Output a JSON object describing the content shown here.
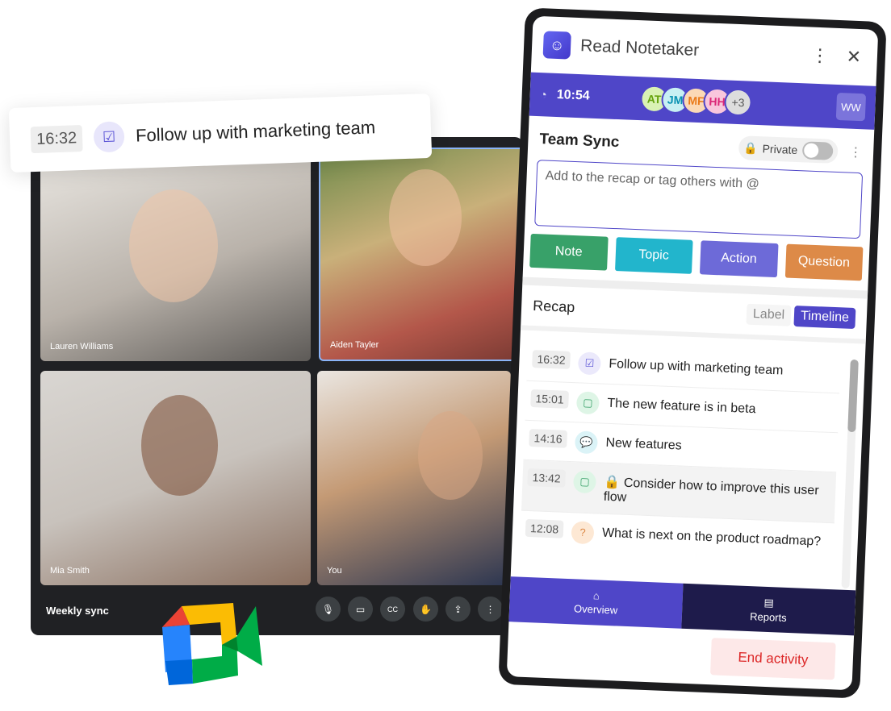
{
  "meet": {
    "title": "Weekly sync",
    "tiles": [
      {
        "name": "Lauren Williams"
      },
      {
        "name": "Aiden Tayler"
      },
      {
        "name": "Mia Smith"
      },
      {
        "name": "You"
      }
    ],
    "controls": [
      "microphone-icon",
      "camera-icon",
      "captions-icon",
      "raise-hand-icon",
      "present-icon",
      "more-icon"
    ]
  },
  "toast": {
    "time": "16:32",
    "text": "Follow up with marketing team"
  },
  "notetaker": {
    "title": "Read Notetaker",
    "timer": "10:54",
    "participants": [
      {
        "initials": "AT",
        "bg": "#d9f2b4",
        "fg": "#65a30d"
      },
      {
        "initials": "JM",
        "bg": "#c8f0f3",
        "fg": "#0891b2"
      },
      {
        "initials": "MF",
        "bg": "#fbd9b6",
        "fg": "#ea7a1a"
      },
      {
        "initials": "HH",
        "bg": "#f9c6dc",
        "fg": "#db2777"
      }
    ],
    "more_participants": "+3",
    "user_initials": "WW",
    "meeting_title": "Team Sync",
    "private_label": "Private",
    "private_on": false,
    "input_placeholder": "Add to the recap or tag others with @",
    "buttons": {
      "note": "Note",
      "topic": "Topic",
      "action": "Action",
      "question": "Question"
    },
    "recap": {
      "title": "Recap",
      "label_tab": "Label",
      "timeline_tab": "Timeline",
      "active": "Timeline",
      "items": [
        {
          "time": "16:32",
          "type": "action",
          "text": "Follow up with marketing team",
          "locked": false
        },
        {
          "time": "15:01",
          "type": "note",
          "text": "The new feature is in beta",
          "locked": false
        },
        {
          "time": "14:16",
          "type": "topic",
          "text": "New features",
          "locked": false
        },
        {
          "time": "13:42",
          "type": "note",
          "text": "Consider how to improve this user flow",
          "locked": true
        },
        {
          "time": "12:08",
          "type": "question",
          "text": "What is next on the product roadmap?",
          "locked": false
        }
      ]
    },
    "nav": {
      "overview": "Overview",
      "reports": "Reports"
    },
    "end_label": "End activity",
    "colors": {
      "primary": "#4f46c8",
      "note": "#38a169",
      "topic": "#22b5cc",
      "action": "#6d6ad8",
      "question": "#dd8a48",
      "nav_dark": "#1e1b4b"
    }
  }
}
